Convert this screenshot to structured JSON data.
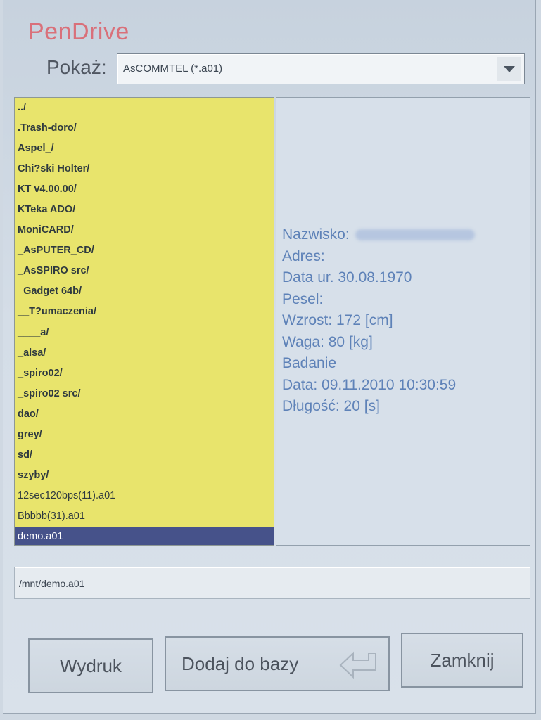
{
  "app": {
    "title": "PenDrive"
  },
  "filter": {
    "label": "Pokaż:",
    "selected": "AsCOMMTEL (*.a01)"
  },
  "files": {
    "items": [
      {
        "name": "../",
        "is_dir": true
      },
      {
        "name": ".Trash-doro/",
        "is_dir": true
      },
      {
        "name": "Aspel_/",
        "is_dir": true
      },
      {
        "name": "Chi?ski Holter/",
        "is_dir": true
      },
      {
        "name": "KT v4.00.00/",
        "is_dir": true
      },
      {
        "name": "KTeka ADO/",
        "is_dir": true
      },
      {
        "name": "MoniCARD/",
        "is_dir": true
      },
      {
        "name": "_AsPUTER_CD/",
        "is_dir": true
      },
      {
        "name": "_AsSPIRO src/",
        "is_dir": true
      },
      {
        "name": "_Gadget 64b/",
        "is_dir": true
      },
      {
        "name": "__T?umaczenia/",
        "is_dir": true
      },
      {
        "name": "____a/",
        "is_dir": true
      },
      {
        "name": "_alsa/",
        "is_dir": true
      },
      {
        "name": "_spiro02/",
        "is_dir": true
      },
      {
        "name": "_spiro02 src/",
        "is_dir": true
      },
      {
        "name": "dao/",
        "is_dir": true
      },
      {
        "name": "grey/",
        "is_dir": true
      },
      {
        "name": "sd/",
        "is_dir": true
      },
      {
        "name": "szyby/",
        "is_dir": true
      },
      {
        "name": "12sec120bps(11).a01",
        "is_dir": false
      },
      {
        "name": "Bbbbb(31).a01",
        "is_dir": false
      },
      {
        "name": "demo.a01",
        "is_dir": false,
        "selected": true
      }
    ]
  },
  "patient": {
    "lines": [
      {
        "text": "Nazwisko:",
        "redacted": true
      },
      {
        "text": "Adres:"
      },
      {
        "text": "Data ur. 30.08.1970"
      },
      {
        "text": "Pesel:"
      },
      {
        "text": "Wzrost: 172 [cm]"
      },
      {
        "text": "Waga: 80 [kg]"
      },
      {
        "text": "Badanie"
      },
      {
        "text": "Data: 09.11.2010   10:30:59"
      },
      {
        "text": "Długość: 20 [s]"
      }
    ]
  },
  "path": {
    "value": "/mnt/demo.a01"
  },
  "buttons": {
    "print": "Wydruk",
    "add_to_db": "Dodaj do bazy",
    "close": "Zamknij"
  },
  "colors": {
    "title": "#d9707a",
    "list_bg": "#e8e46c",
    "selection": "#46528a",
    "info_text": "#5e82b8"
  },
  "icons": {
    "dropdown": "chevron-down-icon",
    "add": "enter-arrow-icon"
  }
}
